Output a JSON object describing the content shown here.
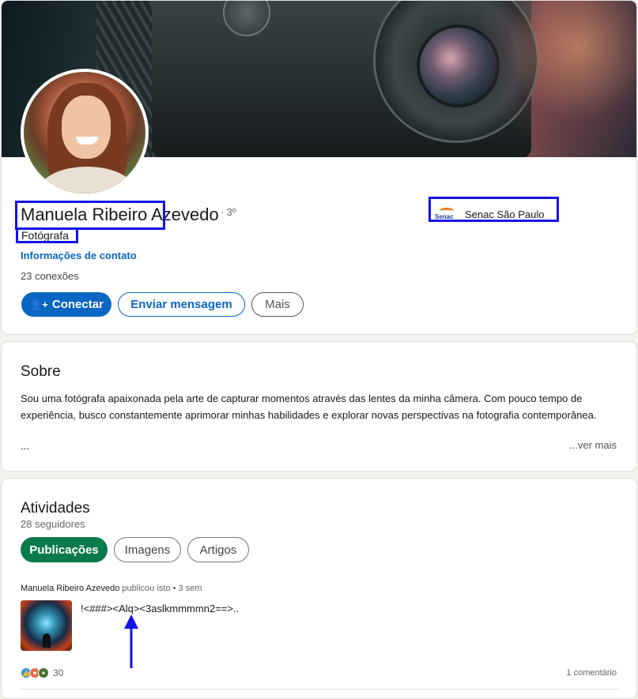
{
  "profile": {
    "first_name": "Manuela Ribeiro",
    "last_name": "Azevedo",
    "degree": "· 3º",
    "headline": "Fotógrafa",
    "contact_link": "Informações de contato",
    "connections": "23 conexões",
    "organization": {
      "name": "Senac São Paulo",
      "logo_text": "Senac"
    },
    "actions": {
      "connect": "Conectar",
      "message": "Enviar mensagem",
      "more": "Mais"
    }
  },
  "about": {
    "title": "Sobre",
    "text": "Sou uma fotógrafa apaixonada pela arte de capturar momentos através das lentes da minha câmera. Com pouco tempo de experiência, busco constantemente aprimorar minhas habilidades e explorar novas perspectivas na fotografia contemporânea.",
    "ellipsis": "...",
    "see_more": "...ver mais"
  },
  "activity": {
    "title": "Atividades",
    "followers": "28 seguidores",
    "tabs": [
      "Publicações",
      "Imagens",
      "Artigos"
    ],
    "post": {
      "author": "Manuela Ribeiro Azevedo",
      "action": " publicou isto • 3 sem",
      "text": "!<###><Alq><3aslkmmmmn2==>..",
      "reaction_count": "30",
      "comments": "1 comentário"
    }
  },
  "colors": {
    "primary": "#0a66c2",
    "active_tab": "#0a7a4a",
    "annotation": "#1414e6"
  }
}
